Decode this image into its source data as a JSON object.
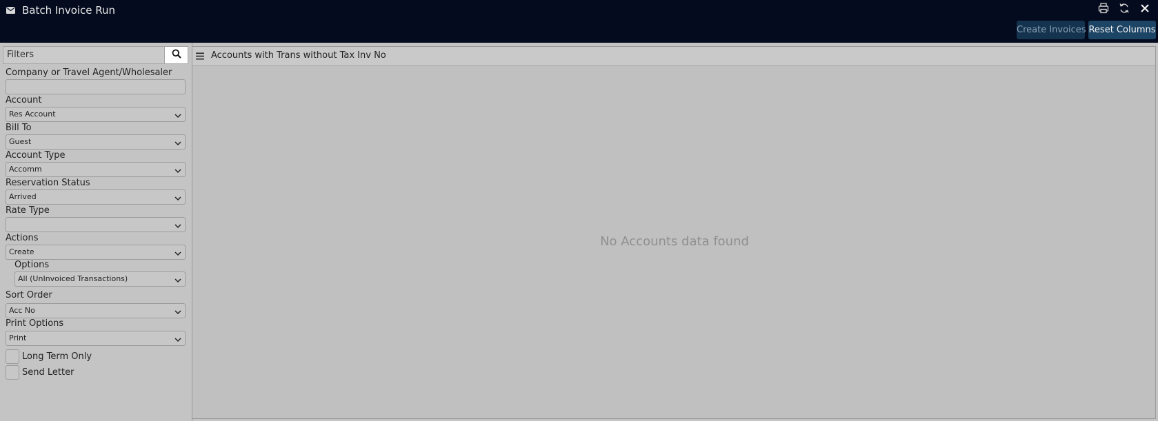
{
  "header": {
    "title": "Batch Invoice Run",
    "icon": "mail-icon",
    "actions": [
      "print-icon",
      "refresh-icon",
      "close-icon"
    ],
    "create_invoices_label": "Create Invoices",
    "reset_columns_label": "Reset Columns"
  },
  "filters": {
    "title": "Filters",
    "company_label": "Company or Travel Agent/Wholesaler",
    "company_value": "",
    "account_label": "Account",
    "account_value": "Res Account",
    "bill_to_label": "Bill To",
    "bill_to_value": "Guest",
    "account_type_label": "Account Type",
    "account_type_value": "Accomm",
    "reservation_status_label": "Reservation Status",
    "reservation_status_value": "Arrived",
    "rate_type_label": "Rate Type",
    "rate_type_value": "",
    "actions_label": "Actions",
    "actions_value": "Create",
    "options_label": "Options",
    "options_value": "All (UnInvoiced Transactions)",
    "sort_order_label": "Sort Order",
    "sort_order_value": "Acc No",
    "print_options_label": "Print Options",
    "print_options_value": "Print",
    "long_term_only_label": "Long Term Only",
    "send_letter_label": "Send Letter"
  },
  "grid": {
    "title": "Accounts with Trans without Tax Inv No",
    "empty_message": "No Accounts data found"
  }
}
